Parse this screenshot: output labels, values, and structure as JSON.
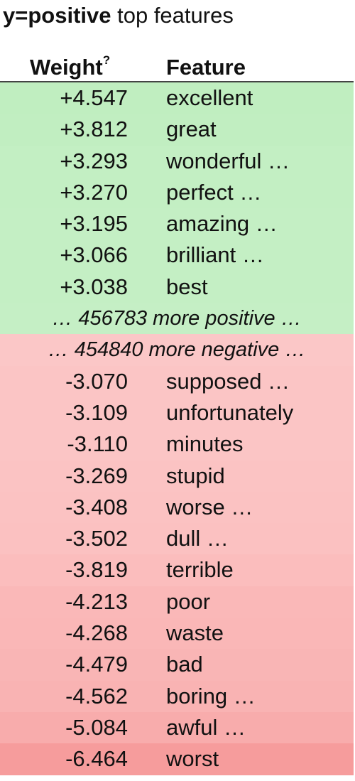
{
  "header": {
    "title_label": "y=positive",
    "title_rest": " top features",
    "col_weight": "Weight",
    "col_weight_sup": "?",
    "col_feature": "Feature"
  },
  "positive": [
    {
      "weight": "+4.547",
      "feature": "excellent",
      "color": "#c0eec0"
    },
    {
      "weight": "+3.812",
      "feature": "great",
      "color": "#c1eec1"
    },
    {
      "weight": "+3.293",
      "feature": "wonderful …",
      "color": "#c3efc3"
    },
    {
      "weight": "+3.270",
      "feature": "perfect …",
      "color": "#c3efc3"
    },
    {
      "weight": "+3.195",
      "feature": "amazing …",
      "color": "#c4efc4"
    },
    {
      "weight": "+3.066",
      "feature": "brilliant …",
      "color": "#c4efc4"
    },
    {
      "weight": "+3.038",
      "feature": "best",
      "color": "#c4efc4"
    }
  ],
  "more_positive": {
    "text": "… 456783 more positive …",
    "color": "#c5efc5"
  },
  "more_negative": {
    "text": "… 454840 more negative …",
    "color": "#fbc7c7"
  },
  "negative": [
    {
      "weight": "-3.070",
      "feature": "supposed …",
      "color": "#fbc5c5"
    },
    {
      "weight": "-3.109",
      "feature": "unfortunately",
      "color": "#fbc5c5"
    },
    {
      "weight": "-3.110",
      "feature": "minutes",
      "color": "#fbc5c5"
    },
    {
      "weight": "-3.269",
      "feature": "stupid",
      "color": "#fbc3c3"
    },
    {
      "weight": "-3.408",
      "feature": "worse …",
      "color": "#fbc2c2"
    },
    {
      "weight": "-3.502",
      "feature": "dull …",
      "color": "#fbc1c1"
    },
    {
      "weight": "-3.819",
      "feature": "terrible",
      "color": "#fbbdbd"
    },
    {
      "weight": "-4.213",
      "feature": "poor",
      "color": "#fab8b8"
    },
    {
      "weight": "-4.268",
      "feature": "waste",
      "color": "#fab7b7"
    },
    {
      "weight": "-4.479",
      "feature": "bad",
      "color": "#f9b5b5"
    },
    {
      "weight": "-4.562",
      "feature": "boring …",
      "color": "#f9b3b3"
    },
    {
      "weight": "-5.084",
      "feature": "awful …",
      "color": "#f8acac"
    },
    {
      "weight": "-6.464",
      "feature": "worst",
      "color": "#f69c9c"
    }
  ]
}
